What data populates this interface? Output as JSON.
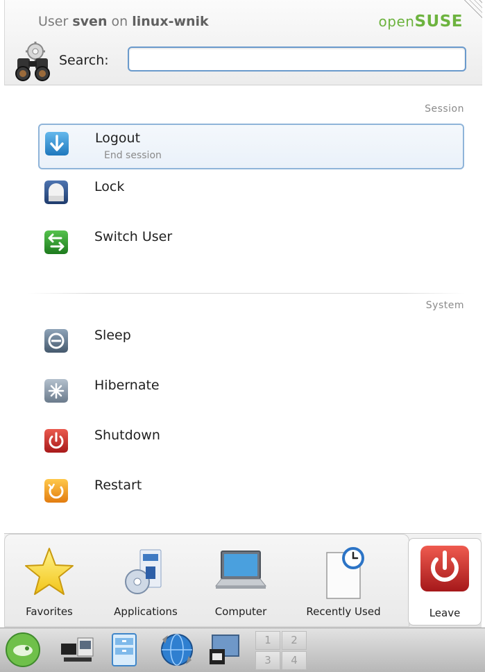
{
  "header": {
    "user_prefix": "User",
    "user_name": "sven",
    "user_mid": "on",
    "host_name": "linux-wnik",
    "brand_open": "open",
    "brand_suse": "SUSE",
    "search_label": "Search:",
    "search_value": "",
    "search_icon": "binoculars-gear-icon"
  },
  "sections": {
    "session": {
      "label": "Session",
      "items": [
        {
          "title": "Logout",
          "subtitle": "End session",
          "icon": "logout-arrow-icon",
          "color": "#2f8fd0"
        },
        {
          "title": "Lock",
          "icon": "lock-icon",
          "color": "#2a4f86"
        },
        {
          "title": "Switch User",
          "icon": "switch-user-icon",
          "color": "#2f9a2f"
        }
      ]
    },
    "system": {
      "label": "System",
      "items": [
        {
          "title": "Sleep",
          "icon": "sleep-icon",
          "color": "#5f7186"
        },
        {
          "title": "Hibernate",
          "icon": "hibernate-icon",
          "color": "#7f8fa1"
        },
        {
          "title": "Shutdown",
          "icon": "shutdown-icon",
          "color": "#c62d2d"
        },
        {
          "title": "Restart",
          "icon": "restart-icon",
          "color": "#f0a31e"
        }
      ]
    }
  },
  "tabs": [
    {
      "label": "Favorites",
      "icon": "star-icon"
    },
    {
      "label": "Applications",
      "icon": "applications-icon"
    },
    {
      "label": "Computer",
      "icon": "laptop-icon"
    },
    {
      "label": "Recently Used",
      "icon": "clock-document-icon"
    },
    {
      "label": "Leave",
      "icon": "power-icon",
      "active": true
    }
  ],
  "taskbar": {
    "icons": [
      "opensuse-gecko-icon",
      "network-icon",
      "file-manager-icon",
      "web-browser-icon",
      "desktop-icon"
    ],
    "pager": [
      "1",
      "2",
      "3",
      "4"
    ]
  }
}
